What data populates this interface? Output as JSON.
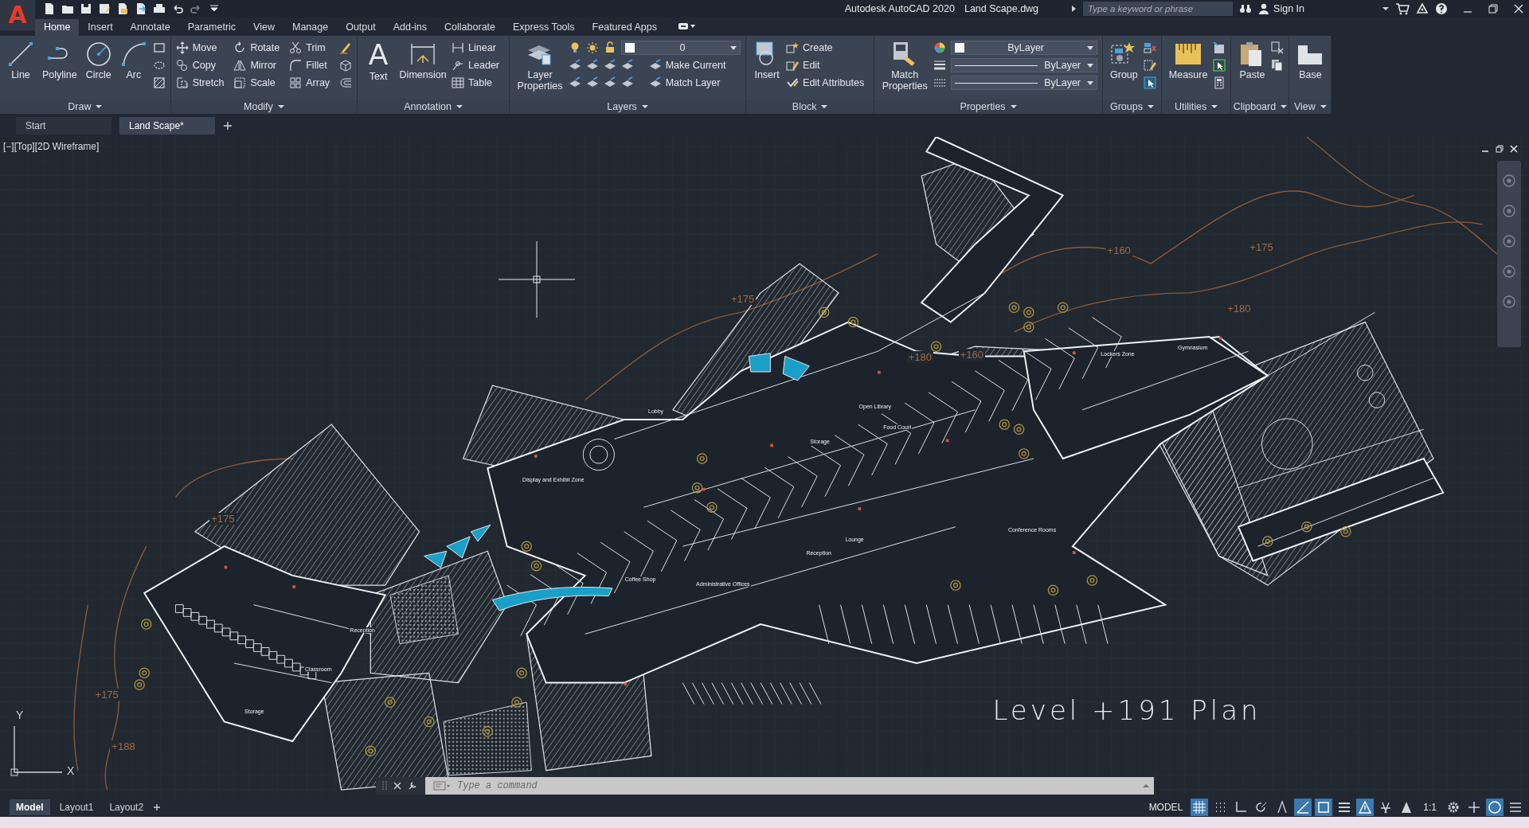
{
  "app": {
    "logo": "A",
    "title": "Autodesk AutoCAD 2020",
    "file": "Land Scape.dwg"
  },
  "search": {
    "placeholder": "Type a keyword or phrase"
  },
  "account": {
    "label": "Sign In"
  },
  "ribbon_tabs": [
    {
      "label": "Home",
      "selected": true
    },
    {
      "label": "Insert",
      "selected": false
    },
    {
      "label": "Annotate",
      "selected": false
    },
    {
      "label": "Parametric",
      "selected": false
    },
    {
      "label": "View",
      "selected": false
    },
    {
      "label": "Manage",
      "selected": false
    },
    {
      "label": "Output",
      "selected": false
    },
    {
      "label": "Add-ins",
      "selected": false
    },
    {
      "label": "Collaborate",
      "selected": false
    },
    {
      "label": "Express Tools",
      "selected": false
    },
    {
      "label": "Featured Apps",
      "selected": false
    }
  ],
  "panels": [
    {
      "title": "Draw",
      "groups": [
        {
          "kind": "big",
          "label": "Line"
        },
        {
          "kind": "big",
          "label": "Polyline"
        },
        {
          "kind": "big",
          "label": "Circle"
        },
        {
          "kind": "big",
          "label": "Arc"
        },
        {
          "kind": "stack",
          "rows": [
            [
              {
                "kind": "icon"
              }
            ],
            [
              {
                "kind": "icon"
              }
            ],
            [
              {
                "kind": "icon"
              }
            ]
          ]
        }
      ]
    },
    {
      "title": "Modify",
      "groups": [
        {
          "kind": "stack",
          "rows": [
            [
              {
                "kind": "small",
                "label": "Move"
              },
              {
                "kind": "small",
                "label": "Rotate"
              },
              {
                "kind": "small",
                "label": "Trim"
              },
              {
                "kind": "icon"
              }
            ],
            [
              {
                "kind": "small",
                "label": "Copy"
              },
              {
                "kind": "small",
                "label": "Mirror"
              },
              {
                "kind": "small",
                "label": "Fillet"
              },
              {
                "kind": "icon"
              }
            ],
            [
              {
                "kind": "small",
                "label": "Stretch"
              },
              {
                "kind": "small",
                "label": "Scale"
              },
              {
                "kind": "small",
                "label": "Array"
              },
              {
                "kind": "icon"
              }
            ]
          ]
        }
      ]
    },
    {
      "title": "Annotation",
      "groups": [
        {
          "kind": "big",
          "label": "Text",
          "glyph": "A"
        },
        {
          "kind": "big",
          "label": "Dimension"
        },
        {
          "kind": "stack",
          "rows": [
            [
              {
                "kind": "small",
                "label": "Linear"
              }
            ],
            [
              {
                "kind": "small",
                "label": "Leader"
              }
            ],
            [
              {
                "kind": "small",
                "label": "Table"
              }
            ]
          ]
        }
      ]
    },
    {
      "title": "Layers",
      "groups": [
        {
          "kind": "big",
          "label": "Layer Properties"
        },
        {
          "kind": "stack",
          "rows": [
            [
              {
                "kind": "icon"
              },
              {
                "kind": "icon"
              },
              {
                "kind": "icon"
              },
              {
                "kind": "dropdown",
                "value": "0"
              }
            ],
            [
              {
                "kind": "icon"
              },
              {
                "kind": "icon"
              },
              {
                "kind": "icon"
              },
              {
                "kind": "icon"
              },
              {
                "kind": "small",
                "label": "Make Current"
              }
            ],
            [
              {
                "kind": "icon"
              },
              {
                "kind": "icon"
              },
              {
                "kind": "icon"
              },
              {
                "kind": "icon"
              },
              {
                "kind": "small",
                "label": "Match Layer"
              }
            ]
          ]
        }
      ]
    },
    {
      "title": "Block",
      "groups": [
        {
          "kind": "big",
          "label": "Insert"
        },
        {
          "kind": "stack",
          "rows": [
            [
              {
                "kind": "small",
                "label": "Create"
              }
            ],
            [
              {
                "kind": "small",
                "label": "Edit"
              }
            ],
            [
              {
                "kind": "small",
                "label": "Edit Attributes"
              }
            ]
          ]
        }
      ]
    },
    {
      "title": "Properties",
      "groups": [
        {
          "kind": "big",
          "label": "Match Properties"
        },
        {
          "kind": "stack",
          "rows": [
            [
              {
                "kind": "icon"
              },
              {
                "kind": "dropdown",
                "value": "ByLayer"
              }
            ],
            [
              {
                "kind": "icon"
              },
              {
                "kind": "dropdown",
                "value": "ByLayer"
              }
            ],
            [
              {
                "kind": "icon"
              },
              {
                "kind": "dropdown",
                "value": "ByLayer"
              }
            ]
          ]
        }
      ]
    },
    {
      "title": "Groups",
      "groups": [
        {
          "kind": "big",
          "label": "Group"
        },
        {
          "kind": "stack",
          "rows": [
            [
              {
                "kind": "icon"
              }
            ],
            [
              {
                "kind": "icon"
              }
            ],
            [
              {
                "kind": "icon"
              }
            ]
          ]
        }
      ]
    },
    {
      "title": "Utilities",
      "groups": [
        {
          "kind": "big",
          "label": "Measure"
        },
        {
          "kind": "stack",
          "rows": [
            [
              {
                "kind": "icon"
              }
            ],
            [
              {
                "kind": "icon"
              }
            ],
            [
              {
                "kind": "icon"
              }
            ]
          ]
        }
      ]
    },
    {
      "title": "Clipboard",
      "groups": [
        {
          "kind": "big",
          "label": "Paste"
        },
        {
          "kind": "stack",
          "rows": [
            [
              {
                "kind": "icon"
              }
            ],
            [
              {
                "kind": "icon"
              }
            ]
          ]
        }
      ]
    },
    {
      "title": "View",
      "groups": [
        {
          "kind": "big",
          "label": "Base"
        }
      ]
    }
  ],
  "doc_tabs": [
    {
      "label": "Start",
      "selected": false
    },
    {
      "label": "Land Scape*",
      "selected": true
    }
  ],
  "viewport": {
    "label": "[−][Top][2D Wireframe]",
    "plan_title": "Level +191 Plan",
    "contour_labels": [
      "+175",
      "+160",
      "+175",
      "+180",
      "+180",
      "+160",
      "+175",
      "+175",
      "+188"
    ],
    "room_labels": [
      "Lobby",
      "Open Library",
      "Food Court",
      "Storage",
      "Lockers Zone",
      "Gymnasium",
      "Lounge",
      "Reception",
      "Coffee Shop",
      "Administrative Offices",
      "Conference Rooms",
      "Display and Exhibit Zone",
      "Reception",
      "Classroom",
      "Storage"
    ],
    "ucs": {
      "x": "X",
      "y": "Y"
    }
  },
  "command_line": {
    "placeholder": "Type a command"
  },
  "layout_tabs": [
    {
      "label": "Model",
      "selected": true
    },
    {
      "label": "Layout1",
      "selected": false
    },
    {
      "label": "Layout2",
      "selected": false
    }
  ],
  "status_bar": {
    "space": "MODEL",
    "scale": "1:1",
    "toggles": [
      {
        "on": true
      },
      {
        "on": false
      },
      {
        "on": false
      },
      {
        "on": false
      },
      {
        "on": false
      },
      {
        "on": true
      },
      {
        "on": true
      },
      {
        "on": false
      },
      {
        "on": true
      },
      {
        "on": false
      },
      {
        "on": false
      },
      {
        "on": false
      },
      {
        "on": false
      },
      {
        "on": true
      },
      {
        "on": false
      }
    ]
  }
}
